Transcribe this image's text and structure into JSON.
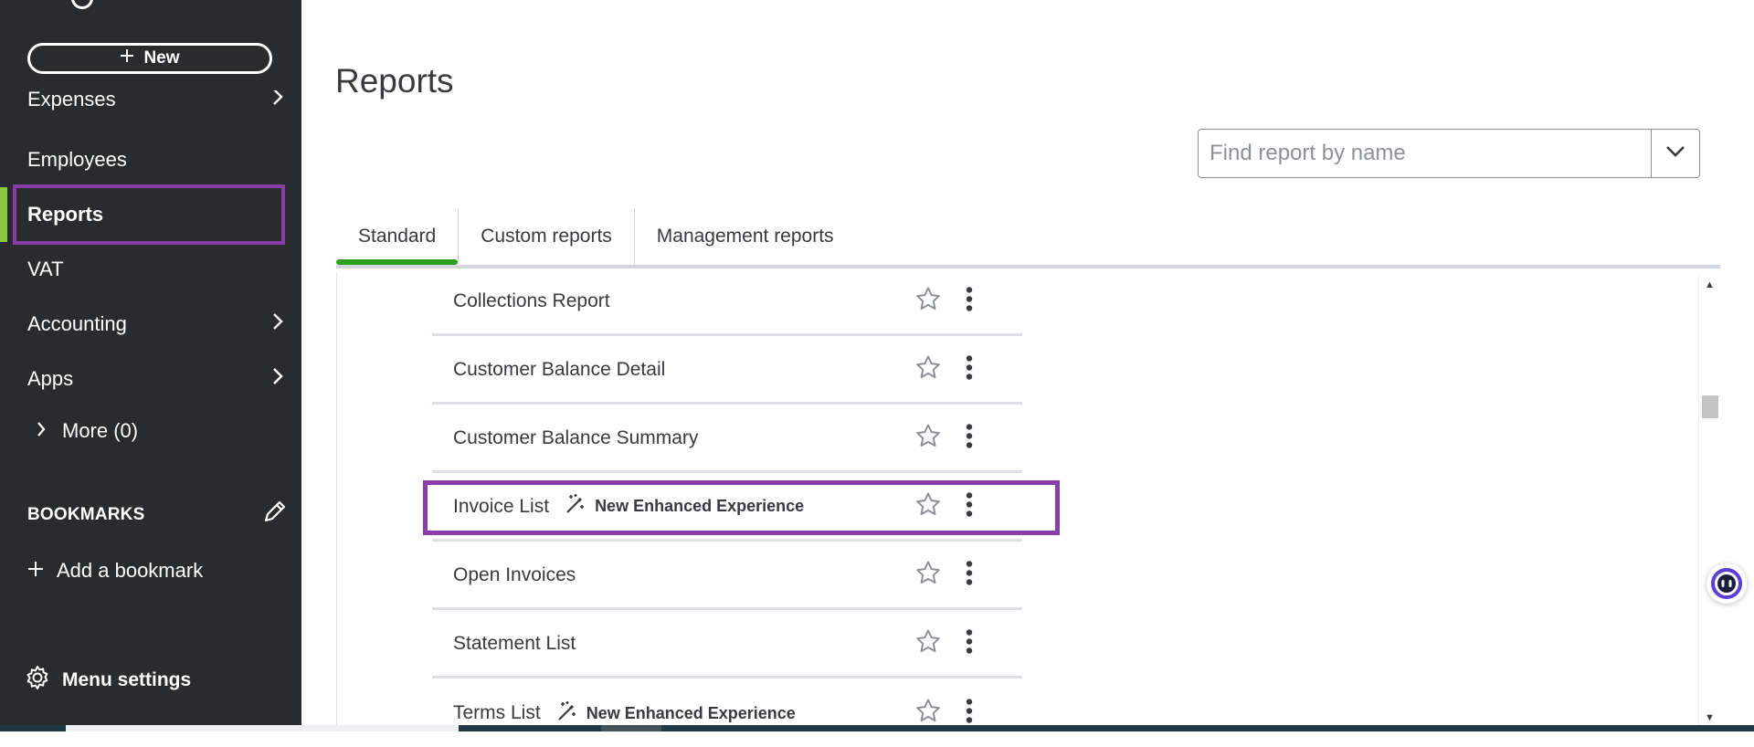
{
  "sidebar": {
    "new_button_label": "New",
    "items": [
      {
        "label": "Expenses",
        "has_chevron": true
      },
      {
        "label": "Employees",
        "has_chevron": false
      },
      {
        "label": "Reports",
        "has_chevron": false,
        "active": true
      },
      {
        "label": "VAT",
        "has_chevron": false
      },
      {
        "label": "Accounting",
        "has_chevron": true
      },
      {
        "label": "Apps",
        "has_chevron": true
      }
    ],
    "more_label": "More (0)",
    "bookmarks_heading": "BOOKMARKS",
    "add_bookmark_label": "Add a bookmark",
    "menu_settings_label": "Menu settings",
    "active_color": "#8dc63f",
    "highlight_color": "#8a3ca9"
  },
  "main": {
    "title": "Reports",
    "search": {
      "placeholder": "Find report by name",
      "value": ""
    },
    "tabs": [
      {
        "label": "Standard",
        "active": true
      },
      {
        "label": "Custom reports",
        "active": false
      },
      {
        "label": "Management reports",
        "active": false
      }
    ],
    "reports": [
      {
        "name": "Collections Report",
        "badge": ""
      },
      {
        "name": "Customer Balance Detail",
        "badge": ""
      },
      {
        "name": "Customer Balance Summary",
        "badge": ""
      },
      {
        "name": "Invoice List",
        "badge": "New Enhanced Experience",
        "highlighted": true
      },
      {
        "name": "Open Invoices",
        "badge": ""
      },
      {
        "name": "Statement List",
        "badge": ""
      },
      {
        "name": "Terms List",
        "badge": "New Enhanced Experience"
      }
    ],
    "accent_color": "#2ca01c"
  }
}
